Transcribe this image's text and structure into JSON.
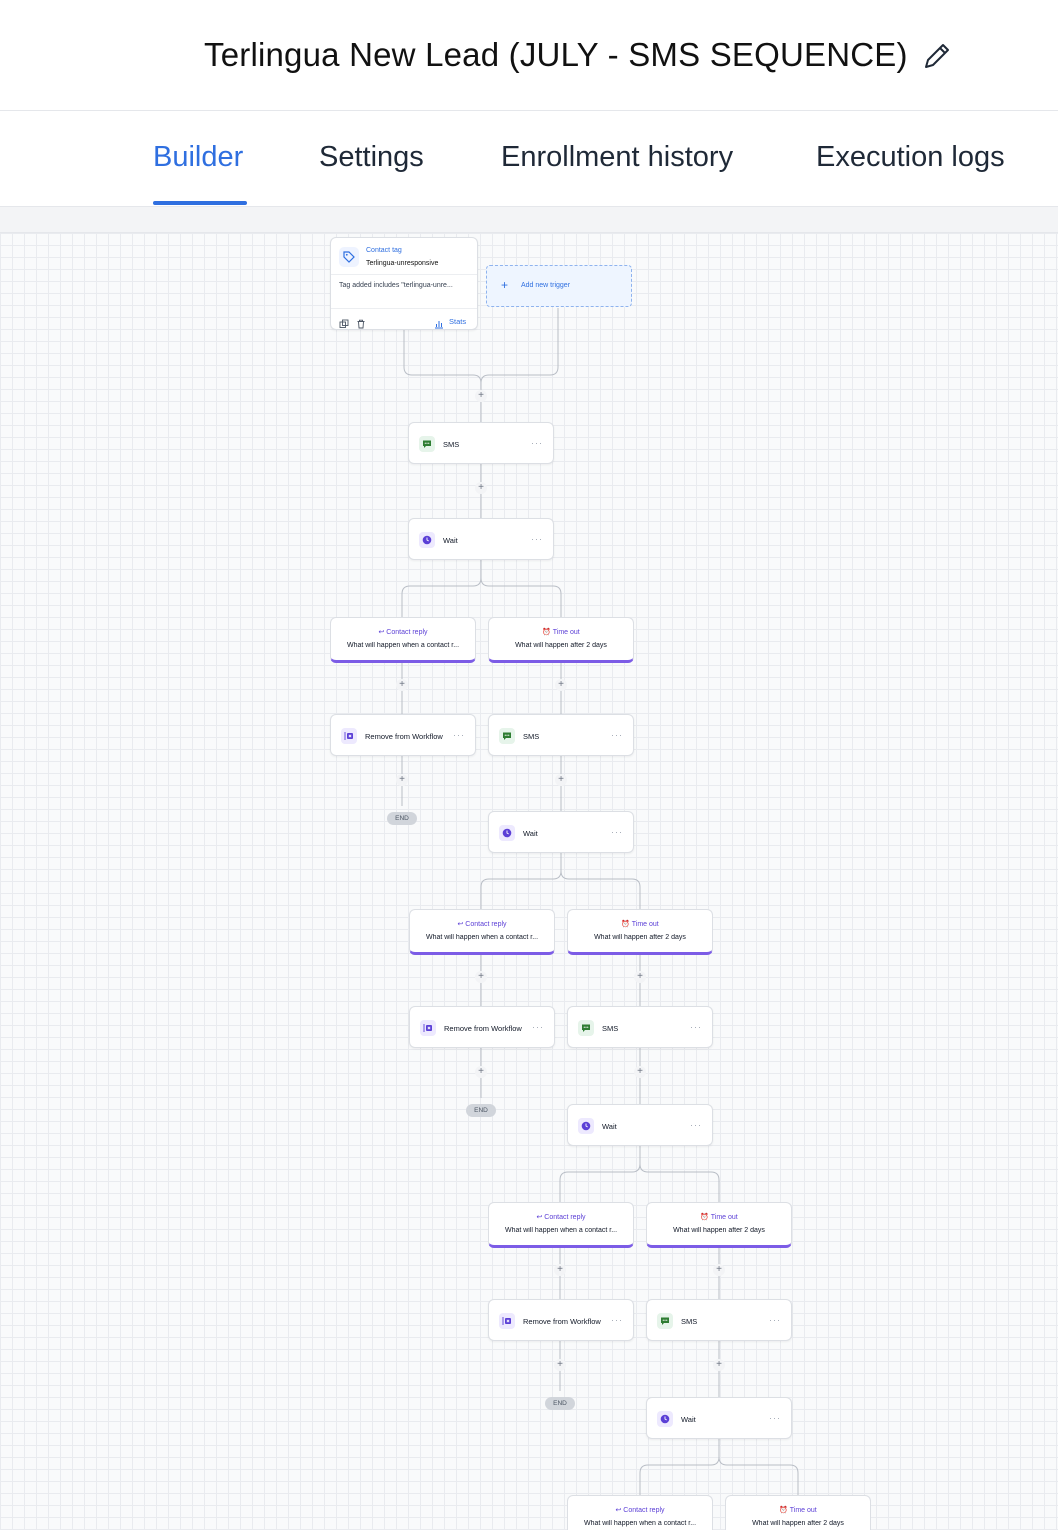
{
  "workflow": {
    "title": "Terlingua New Lead (JULY - SMS SEQUENCE)"
  },
  "tabs": [
    "Builder",
    "Settings",
    "Enrollment history",
    "Execution logs"
  ],
  "active_tab": "Builder",
  "trigger": {
    "type_label": "Contact tag",
    "tag_name": "Terlingua-unresponsive",
    "condition": "Tag added includes \"terlingua-unre...",
    "stats_label": "Stats",
    "add_trigger_label": "Add new trigger"
  },
  "labels": {
    "sms": "SMS",
    "wait": "Wait",
    "remove": "Remove from Workflow",
    "end": "END",
    "contact_reply_title": "Contact reply",
    "contact_reply_desc": "What will happen when a contact r...",
    "timeout_title": "Time out",
    "timeout_desc": "What will happen after 2 days",
    "more": "···",
    "plus": "+"
  },
  "colors": {
    "accent": "#2f6fe0",
    "branch": "#7c5ce6",
    "sms_icon": "#2e7d32",
    "wait_icon": "#5b3fd6"
  }
}
